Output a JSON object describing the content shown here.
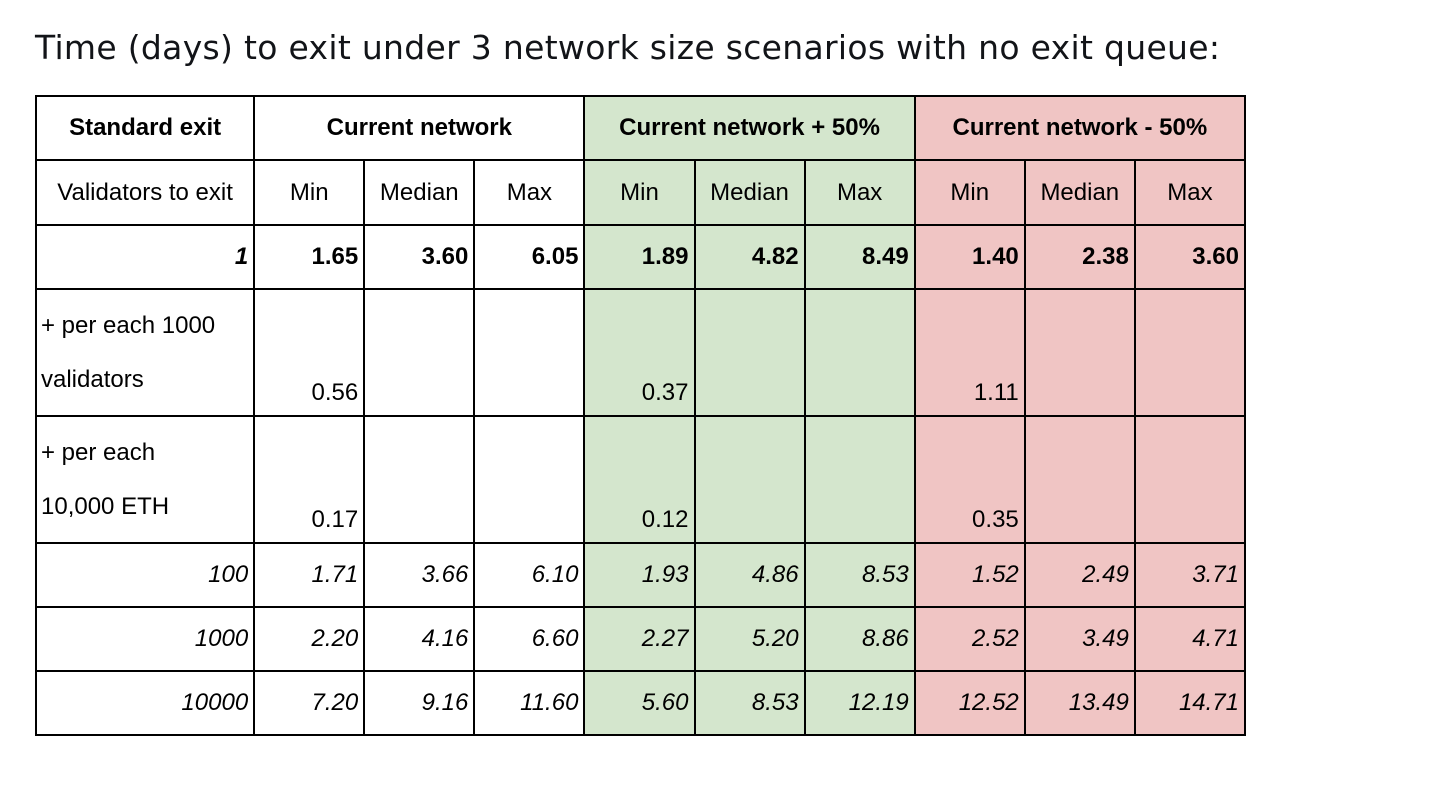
{
  "title": "Time (days) to exit under 3 network size scenarios with no exit queue:",
  "colors": {
    "plus50_background": "#d4e6cd",
    "minus50_background": "#f0c5c4",
    "current_background": "#ffffff",
    "border": "#000000"
  },
  "table": {
    "group_headers": {
      "standard_exit": "Standard exit",
      "current": "Current network",
      "plus50": "Current network + 50%",
      "minus50": "Current network - 50%"
    },
    "sub_headers": {
      "label": "Validators to exit",
      "min": "Min",
      "median": "Median",
      "max": "Max"
    },
    "rows": [
      {
        "label": "1",
        "current": [
          "1.65",
          "3.60",
          "6.05"
        ],
        "plus50": [
          "1.89",
          "4.82",
          "8.49"
        ],
        "minus50": [
          "1.40",
          "2.38",
          "3.60"
        ]
      },
      {
        "label_line1": "+ per each 1000",
        "label_line2": "validators",
        "current": [
          "0.56",
          "",
          ""
        ],
        "plus50": [
          "0.37",
          "",
          ""
        ],
        "minus50": [
          "1.11",
          "",
          ""
        ]
      },
      {
        "label_line1": "+ per each",
        "label_line2": "10,000 ETH",
        "current": [
          "0.17",
          "",
          ""
        ],
        "plus50": [
          "0.12",
          "",
          ""
        ],
        "minus50": [
          "0.35",
          "",
          ""
        ]
      },
      {
        "label": "100",
        "current": [
          "1.71",
          "3.66",
          "6.10"
        ],
        "plus50": [
          "1.93",
          "4.86",
          "8.53"
        ],
        "minus50": [
          "1.52",
          "2.49",
          "3.71"
        ]
      },
      {
        "label": "1000",
        "current": [
          "2.20",
          "4.16",
          "6.60"
        ],
        "plus50": [
          "2.27",
          "5.20",
          "8.86"
        ],
        "minus50": [
          "2.52",
          "3.49",
          "4.71"
        ]
      },
      {
        "label": "10000",
        "current": [
          "7.20",
          "9.16",
          "11.60"
        ],
        "plus50": [
          "5.60",
          "8.53",
          "12.19"
        ],
        "minus50": [
          "12.52",
          "13.49",
          "14.71"
        ]
      }
    ]
  }
}
